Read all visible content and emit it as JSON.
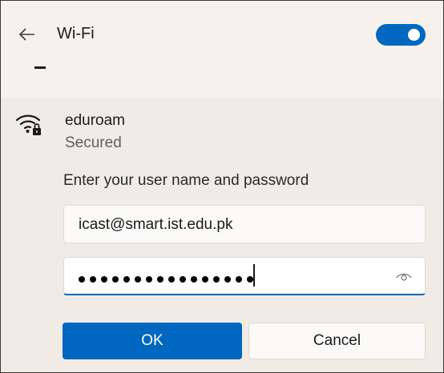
{
  "header": {
    "title": "Wi-Fi",
    "toggle_on": true,
    "accent_color": "#0067c0"
  },
  "network": {
    "name": "eduroam",
    "status": "Secured",
    "icon": "wifi-secured-icon"
  },
  "form": {
    "prompt": "Enter your user name and password",
    "username_value": "icast@smart.ist.edu.pk",
    "password_masked_length": 16
  },
  "buttons": {
    "ok_label": "OK",
    "cancel_label": "Cancel"
  }
}
